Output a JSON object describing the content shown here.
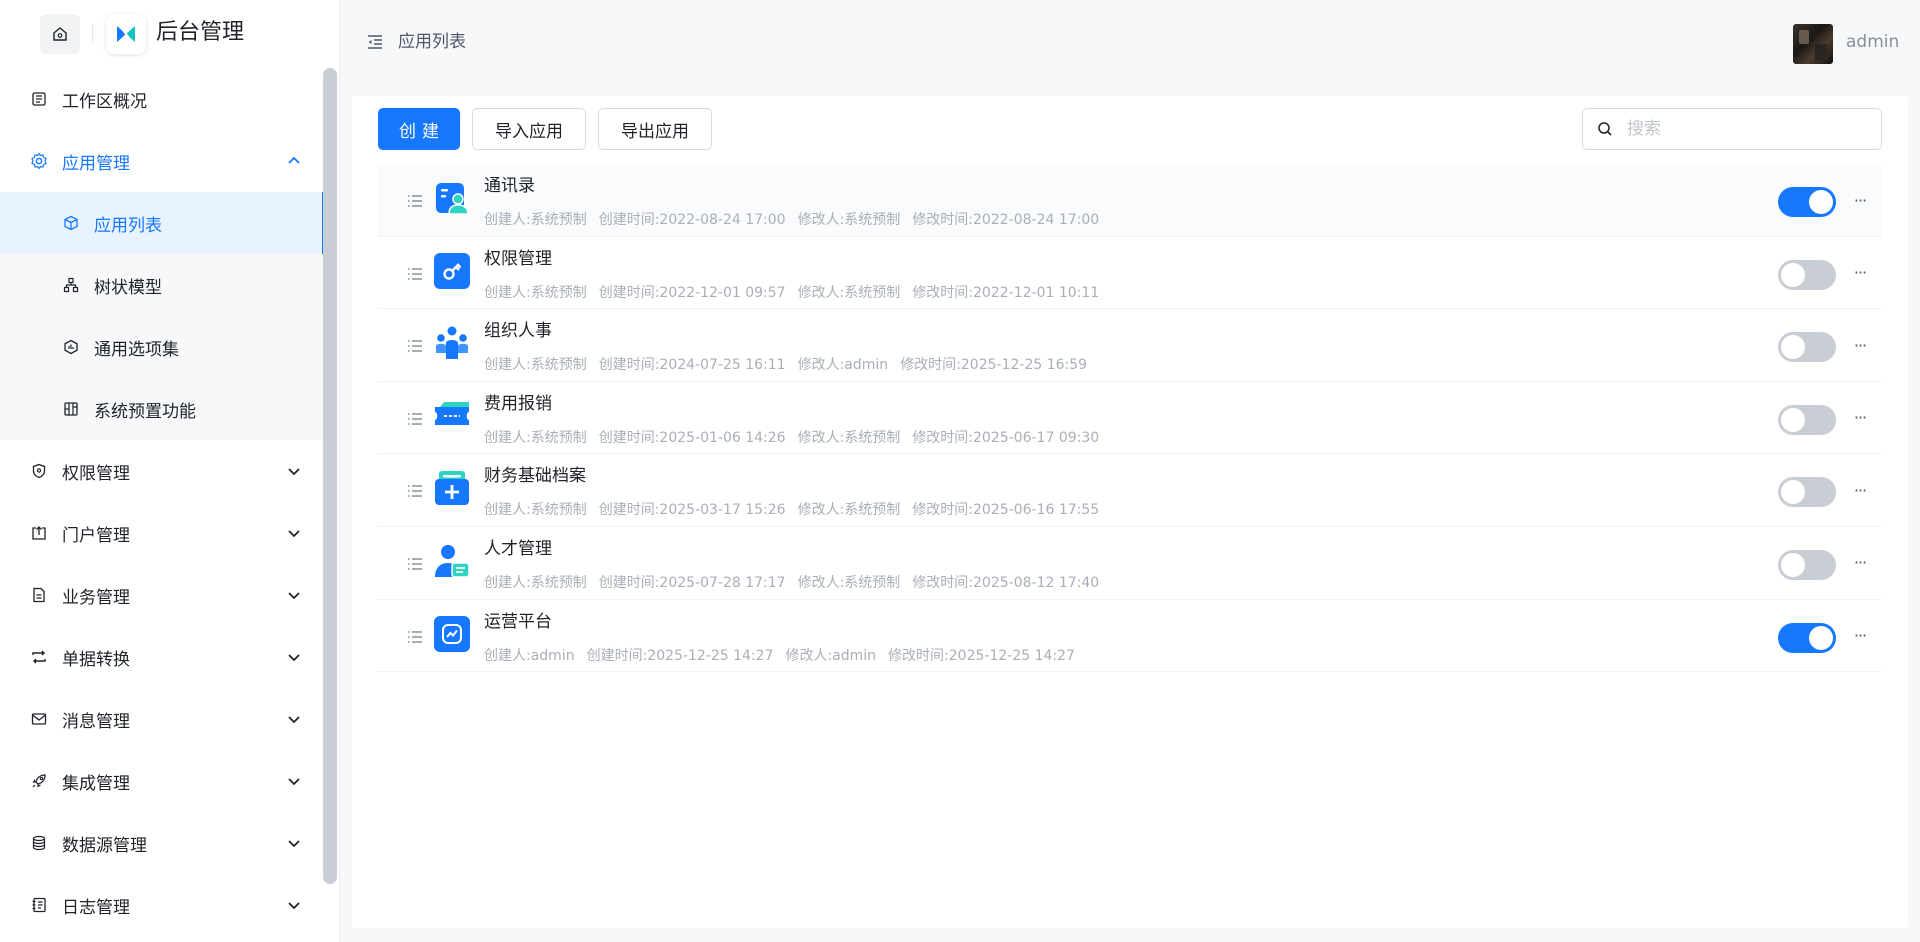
{
  "brand": {
    "title": "后台管理"
  },
  "header": {
    "breadcrumb": "应用列表",
    "user_name": "admin"
  },
  "sidebar": {
    "items": [
      {
        "label": "工作区概况",
        "icon": "dashboard-icon"
      },
      {
        "label": "应用管理",
        "icon": "gear-icon",
        "open": true,
        "children": [
          {
            "label": "应用列表",
            "icon": "cube-icon",
            "active": true
          },
          {
            "label": "树状模型",
            "icon": "tree-icon"
          },
          {
            "label": "通用选项集",
            "icon": "hexagon-icon"
          },
          {
            "label": "系统预置功能",
            "icon": "grid-icon"
          }
        ]
      },
      {
        "label": "权限管理",
        "icon": "shield-icon"
      },
      {
        "label": "门户管理",
        "icon": "portal-icon"
      },
      {
        "label": "业务管理",
        "icon": "document-icon"
      },
      {
        "label": "单据转换",
        "icon": "swap-icon"
      },
      {
        "label": "消息管理",
        "icon": "mail-icon"
      },
      {
        "label": "集成管理",
        "icon": "rocket-icon"
      },
      {
        "label": "数据源管理",
        "icon": "database-icon"
      },
      {
        "label": "日志管理",
        "icon": "log-icon"
      }
    ]
  },
  "toolbar": {
    "create_label": "创建",
    "import_label": "导入应用",
    "export_label": "导出应用"
  },
  "search": {
    "placeholder": "搜索"
  },
  "apps": [
    {
      "name": "通讯录",
      "creator": "创建人:系统预制",
      "created": "创建时间:2022-08-24 17:00",
      "modifier": "修改人:系统预制",
      "modified": "修改时间:2022-08-24 17:00",
      "enabled": true,
      "icon": "contacts-icon"
    },
    {
      "name": "权限管理",
      "creator": "创建人:系统预制",
      "created": "创建时间:2022-12-01 09:57",
      "modifier": "修改人:系统预制",
      "modified": "修改时间:2022-12-01 10:11",
      "enabled": false,
      "icon": "key-icon"
    },
    {
      "name": "组织人事",
      "creator": "创建人:系统预制",
      "created": "创建时间:2024-07-25 16:11",
      "modifier": "修改人:admin",
      "modified": "修改时间:2025-12-25 16:59",
      "enabled": false,
      "icon": "team-icon"
    },
    {
      "name": "费用报销",
      "creator": "创建人:系统预制",
      "created": "创建时间:2025-01-06 14:26",
      "modifier": "修改人:系统预制",
      "modified": "修改时间:2025-06-17 09:30",
      "enabled": false,
      "icon": "ticket-icon"
    },
    {
      "name": "财务基础档案",
      "creator": "创建人:系统预制",
      "created": "创建时间:2025-03-17 15:26",
      "modifier": "修改人:系统预制",
      "modified": "修改时间:2025-06-16 17:55",
      "enabled": false,
      "icon": "folder-plus-icon"
    },
    {
      "name": "人才管理",
      "creator": "创建人:系统预制",
      "created": "创建时间:2025-07-28 17:17",
      "modifier": "修改人:系统预制",
      "modified": "修改时间:2025-08-12 17:40",
      "enabled": false,
      "icon": "person-card-icon"
    },
    {
      "name": "运营平台",
      "creator": "创建人:admin",
      "created": "创建时间:2025-12-25 14:27",
      "modifier": "修改人:admin",
      "modified": "修改时间:2025-12-25 14:27",
      "enabled": true,
      "icon": "chart-app-icon"
    }
  ],
  "colors": {
    "primary": "#1677ff",
    "toggle_off": "#c9cdd4",
    "meta_text": "#a9aeb8"
  }
}
